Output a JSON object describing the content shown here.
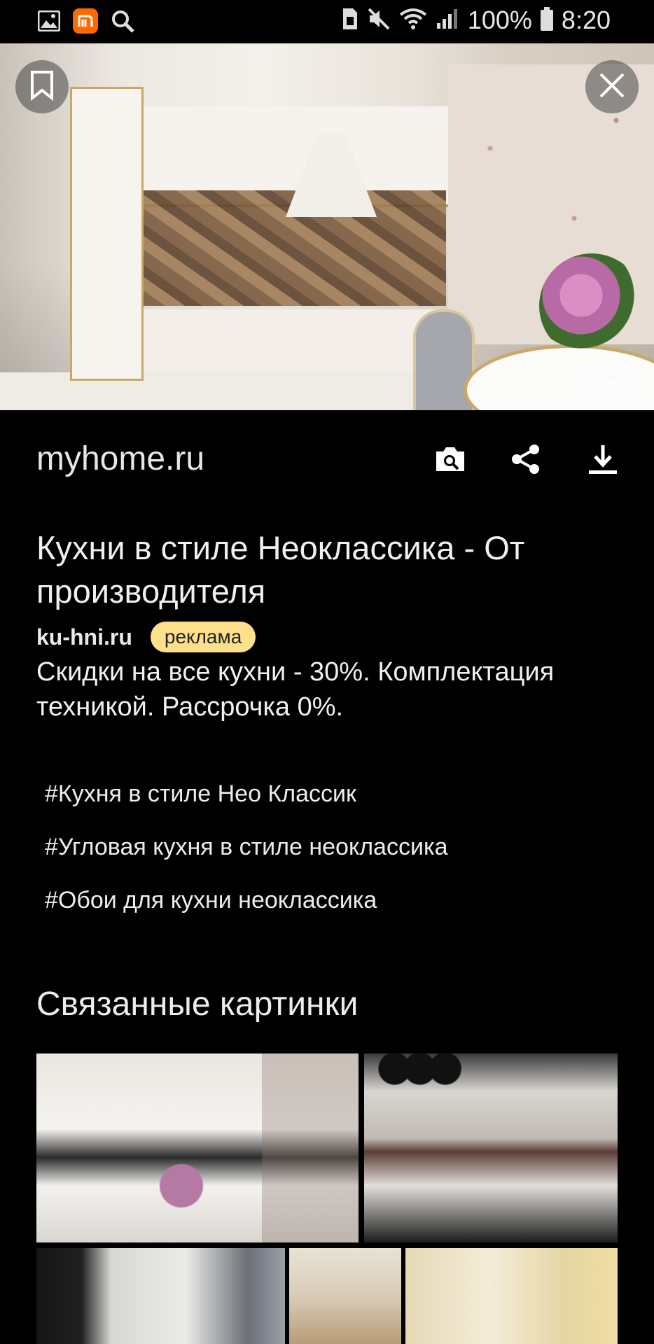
{
  "status_bar": {
    "battery": "100%",
    "time": "8:20"
  },
  "image": {
    "watermark": "myhome.ru"
  },
  "source": {
    "domain": "myhome.ru"
  },
  "ad": {
    "title": "Кухни в стиле Неоклассика - От производителя",
    "domain": "ku-hni.ru",
    "badge": "реклама",
    "description": "Скидки на все кухни - 30%. Комплектация техникой. Рассрочка 0%."
  },
  "tags": [
    "#Кухня в стиле Нео Классик",
    "#Угловая кухня в стиле неоклассика",
    "#Обои для кухни неоклассика"
  ],
  "related": {
    "title": "Связанные картинки"
  },
  "colors": {
    "background": "#000000",
    "ad_badge": "#ffe08a"
  }
}
